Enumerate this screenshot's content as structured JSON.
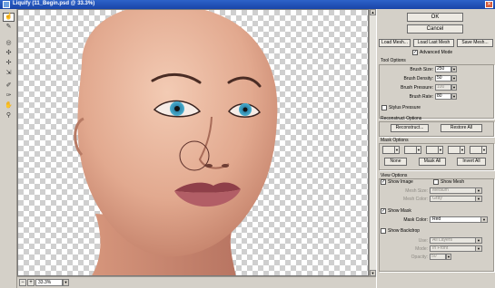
{
  "window": {
    "title": "Liquify (11_Begin.psd @ 33.3%)",
    "close_glyph": "✕"
  },
  "tools": [
    {
      "name": "forward-warp-tool-icon",
      "glyph": "☝"
    },
    {
      "name": "reconstruct-tool-icon",
      "glyph": "✎"
    },
    {
      "name": "twirl-tool-icon",
      "glyph": "◎"
    },
    {
      "name": "pucker-tool-icon",
      "glyph": "✣"
    },
    {
      "name": "bloat-tool-icon",
      "glyph": "✢"
    },
    {
      "name": "push-left-tool-icon",
      "glyph": "⇲"
    },
    {
      "name": "freeze-mask-tool-icon",
      "glyph": "✐"
    },
    {
      "name": "thaw-mask-tool-icon",
      "glyph": "✑"
    },
    {
      "name": "hand-tool-icon",
      "glyph": "✋"
    },
    {
      "name": "zoom-tool-icon",
      "glyph": "⚲"
    }
  ],
  "status": {
    "zoom_value": "33.3%",
    "zoom_out": "−",
    "zoom_in": "+"
  },
  "panel": {
    "ok_label": "OK",
    "cancel_label": "Cancel",
    "load_mesh_label": "Load Mesh...",
    "load_last_mesh_label": "Load Last Mesh",
    "save_mesh_label": "Save Mesh...",
    "advanced_mode_label": "Advanced Mode",
    "tool_options": {
      "title": "Tool Options",
      "brush_size_label": "Brush Size:",
      "brush_size_value": "250",
      "brush_density_label": "Brush Density:",
      "brush_density_value": "50",
      "brush_pressure_label": "Brush Pressure:",
      "brush_pressure_value": "100",
      "brush_rate_label": "Brush Rate:",
      "brush_rate_value": "80",
      "stylus_pressure_label": "Stylus Pressure"
    },
    "reconstruct_options": {
      "title": "Reconstruct Options",
      "reconstruct_label": "Reconstruct...",
      "restore_all_label": "Restore All"
    },
    "mask_options": {
      "title": "Mask Options",
      "none_label": "None",
      "mask_all_label": "Mask All",
      "invert_all_label": "Invert All"
    },
    "view_options": {
      "title": "View Options",
      "show_image_label": "Show Image",
      "show_mesh_label": "Show Mesh",
      "mesh_size_label": "Mesh Size:",
      "mesh_size_value": "Medium",
      "mesh_color_label": "Mesh Color:",
      "mesh_color_value": "Gray",
      "show_mask_label": "Show Mask",
      "mask_color_label": "Mask Color:",
      "mask_color_value": "Red",
      "show_backdrop_label": "Show Backdrop",
      "use_label": "Use:",
      "use_value": "All Layers",
      "mode_label": "Mode:",
      "mode_value": "In Front",
      "opacity_label": "Opacity:",
      "opacity_value": "50"
    }
  },
  "colors": {
    "titlebar": "#1f4fb4",
    "panel_bg": "#d4d0c8",
    "skin_light": "#e8b49a",
    "skin_shadow": "#c58570",
    "eye_iris": "#3d96b8",
    "lip": "#9e4c55"
  }
}
